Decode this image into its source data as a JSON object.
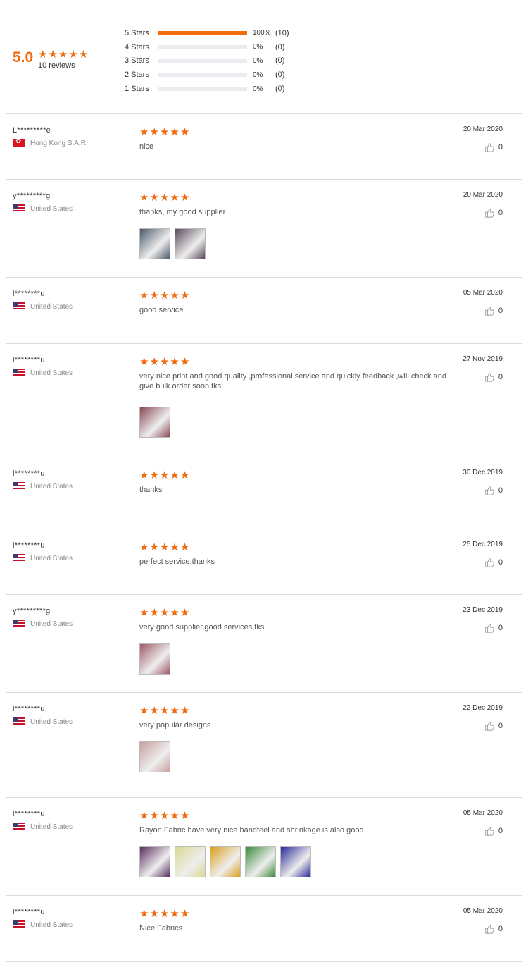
{
  "summary": {
    "score": "5.0",
    "review_count": "10 reviews",
    "distribution": [
      {
        "label": "5 Stars",
        "percent": "100%",
        "count": "(10)",
        "fraction": 1.0
      },
      {
        "label": "4 Stars",
        "percent": "0%",
        "count": "(0)",
        "fraction": 0
      },
      {
        "label": "3 Stars",
        "percent": "0%",
        "count": "(0)",
        "fraction": 0
      },
      {
        "label": "2 Stars",
        "percent": "0%",
        "count": "(0)",
        "fraction": 0
      },
      {
        "label": "1 Stars",
        "percent": "0%",
        "count": "(0)",
        "fraction": 0
      }
    ]
  },
  "colors": {
    "accent": "#f06a0e",
    "bar_track": "#ebebf0",
    "divider": "#dcdcdc"
  },
  "reviews": [
    {
      "author": "L*********e",
      "country": "Hong Kong S.A.R.",
      "flag": "hk",
      "rating": 5,
      "text": "nice",
      "date": "20 Mar 2020",
      "likes": "0",
      "photos": []
    },
    {
      "author": "y*********g",
      "country": "United States",
      "flag": "us",
      "rating": 5,
      "text": "thanks,   my good supplier",
      "date": "20 Mar 2020",
      "likes": "0",
      "photos": [
        "#4a5a6a",
        "#5a4a5a"
      ]
    },
    {
      "author": "l********u",
      "country": "United States",
      "flag": "us",
      "rating": 5,
      "text": "good service",
      "date": "05 Mar 2020",
      "likes": "0",
      "photos": []
    },
    {
      "author": "l********u",
      "country": "United States",
      "flag": "us",
      "rating": 5,
      "text": "very nice print and good quality ,professional service and quickly feedback ,will check and give bulk order soon,tks",
      "date": "27 Nov 2019",
      "likes": "0",
      "photos": [
        "#8a4a55"
      ]
    },
    {
      "author": "l********u",
      "country": "United States",
      "flag": "us",
      "rating": 5,
      "text": "thanks",
      "date": "30 Dec 2019",
      "likes": "0",
      "photos": []
    },
    {
      "author": "l********u",
      "country": "United States",
      "flag": "us",
      "rating": 5,
      "text": "perfect service,thanks",
      "date": "25 Dec 2019",
      "likes": "0",
      "photos": []
    },
    {
      "author": "y*********g",
      "country": "United States",
      "flag": "us",
      "rating": 5,
      "text": "very good supplier,good services,tks",
      "date": "23 Dec 2019",
      "likes": "0",
      "photos": [
        "#a05a68"
      ]
    },
    {
      "author": "l********u",
      "country": "United States",
      "flag": "us",
      "rating": 5,
      "text": "very popular designs",
      "date": "22 Dec 2019",
      "likes": "0",
      "photos": [
        "#c9a0a0"
      ]
    },
    {
      "author": "l********u",
      "country": "United States",
      "flag": "us",
      "rating": 5,
      "text": "Rayon Fabric have very nice handfeel and shrinkage is also good",
      "date": "05 Mar 2020",
      "likes": "0",
      "photos": [
        "#5a3060",
        "#d8d890",
        "#d8a020",
        "#3a8a3a",
        "#2a2a9a"
      ]
    },
    {
      "author": "l********u",
      "country": "United States",
      "flag": "us",
      "rating": 5,
      "text": "Nice Fabrics",
      "date": "05 Mar 2020",
      "likes": "0",
      "photos": []
    }
  ]
}
